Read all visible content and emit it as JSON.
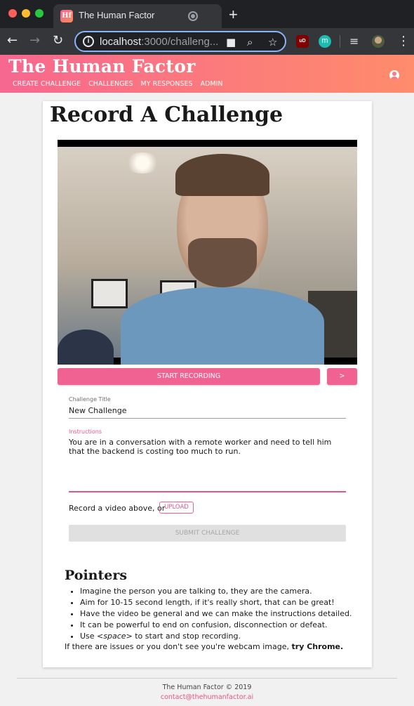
{
  "browser": {
    "tab_title": "The Human Factor",
    "favicon_text": "Hf",
    "new_tab_label": "+",
    "url_host": "localhost",
    "url_rest": ":3000/challeng...",
    "back_icon": "←",
    "forward_icon": "→",
    "reload_icon": "↻",
    "info_icon": "i",
    "extension_ublock": "uD",
    "extension_m": "m"
  },
  "app": {
    "brand": "The Human Factor",
    "nav": [
      "Create Challenge",
      "Challenges",
      "My Responses",
      "Admin"
    ]
  },
  "page": {
    "title": "Record A Challenge",
    "record_button": "Start Recording",
    "next_button": ">",
    "challenge_title_label": "Challenge Title",
    "challenge_title_value": "New Challenge",
    "instructions_label": "Instructions",
    "instructions_value": "You are in a conversation with a remote worker and need to tell him that the backend is costing too much to run.",
    "upload_prompt": "Record a video above, or",
    "upload_button": "Upload",
    "submit_button": "Submit Challenge"
  },
  "pointers": {
    "heading": "Pointers",
    "items": [
      "Imagine the person you are talking to, they are the camera.",
      "Aim for 10-15 second length, if it's really short, that can be great!",
      "Have the video be general and we can make the instructions detailed.",
      "It can be powerful to end on confusion, disconnection or defeat."
    ],
    "space_prefix": "Use ",
    "space_key": "<space>",
    "space_suffix": " to start and stop recording.",
    "issues_text": "If there are issues or you don't see you're webcam image, ",
    "issues_link": "try Chrome."
  },
  "footer": {
    "copyright": "The Human Factor © 2019",
    "email": "contact@thehumanfactor.ai"
  },
  "colors": {
    "accent": "#f06292",
    "header_gradient_start": "#f7678f",
    "header_gradient_end": "#ff8c6b",
    "chrome_dark": "#202124"
  }
}
